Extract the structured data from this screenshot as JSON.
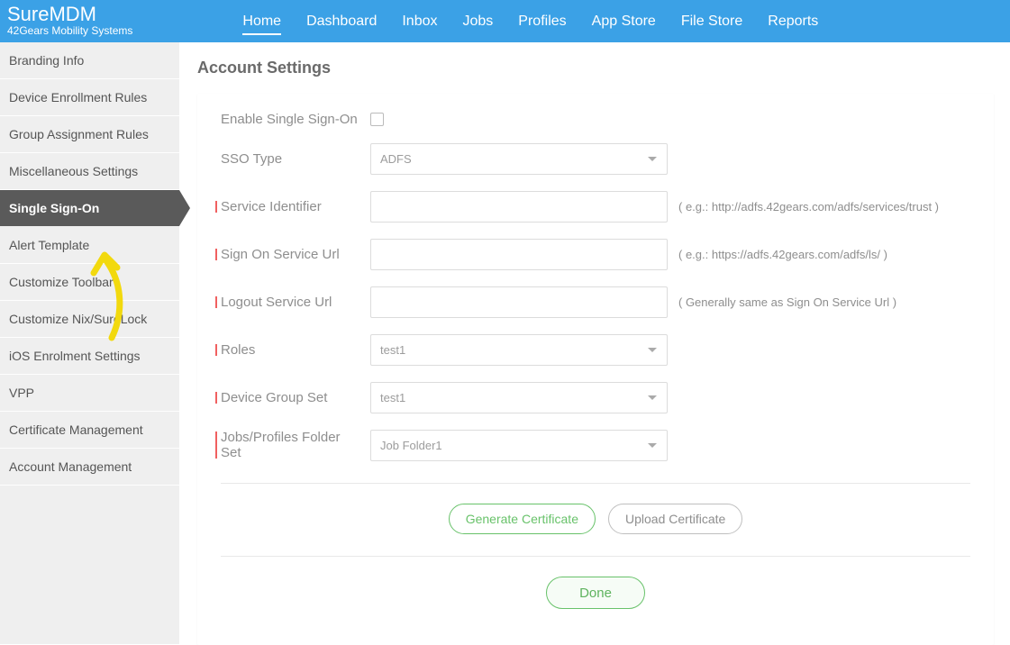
{
  "brand": {
    "name": "SureMDM",
    "sub": "42Gears Mobility Systems"
  },
  "nav": {
    "items": [
      "Home",
      "Dashboard",
      "Inbox",
      "Jobs",
      "Profiles",
      "App Store",
      "File Store",
      "Reports"
    ],
    "activeIndex": 0
  },
  "sidebar": {
    "items": [
      "Branding Info",
      "Device Enrollment Rules",
      "Group Assignment Rules",
      "Miscellaneous Settings",
      "Single Sign-On",
      "Alert Template",
      "Customize Toolbar",
      "Customize Nix/SureLock",
      "iOS Enrolment Settings",
      "VPP",
      "Certificate Management",
      "Account Management"
    ],
    "activeIndex": 4
  },
  "page": {
    "title": "Account Settings"
  },
  "form": {
    "enable": {
      "label": "Enable Single Sign-On",
      "checked": false
    },
    "ssoType": {
      "label": "SSO Type",
      "value": "ADFS"
    },
    "serviceIdentifier": {
      "label": "Service Identifier",
      "value": "",
      "hint": "( e.g.: http://adfs.42gears.com/adfs/services/trust )"
    },
    "signOnUrl": {
      "label": "Sign On Service Url",
      "value": "",
      "hint": "( e.g.: https://adfs.42gears.com/adfs/ls/ )"
    },
    "logoutUrl": {
      "label": "Logout Service Url",
      "value": "",
      "hint": "( Generally same as Sign On Service Url )"
    },
    "roles": {
      "label": "Roles",
      "value": "test1"
    },
    "deviceGroupSet": {
      "label": "Device Group Set",
      "value": "test1"
    },
    "jobsFolderSet": {
      "label": "Jobs/Profiles Folder Set",
      "value": "Job Folder1"
    }
  },
  "buttons": {
    "generate": "Generate Certificate",
    "upload": "Upload Certificate",
    "done": "Done"
  }
}
